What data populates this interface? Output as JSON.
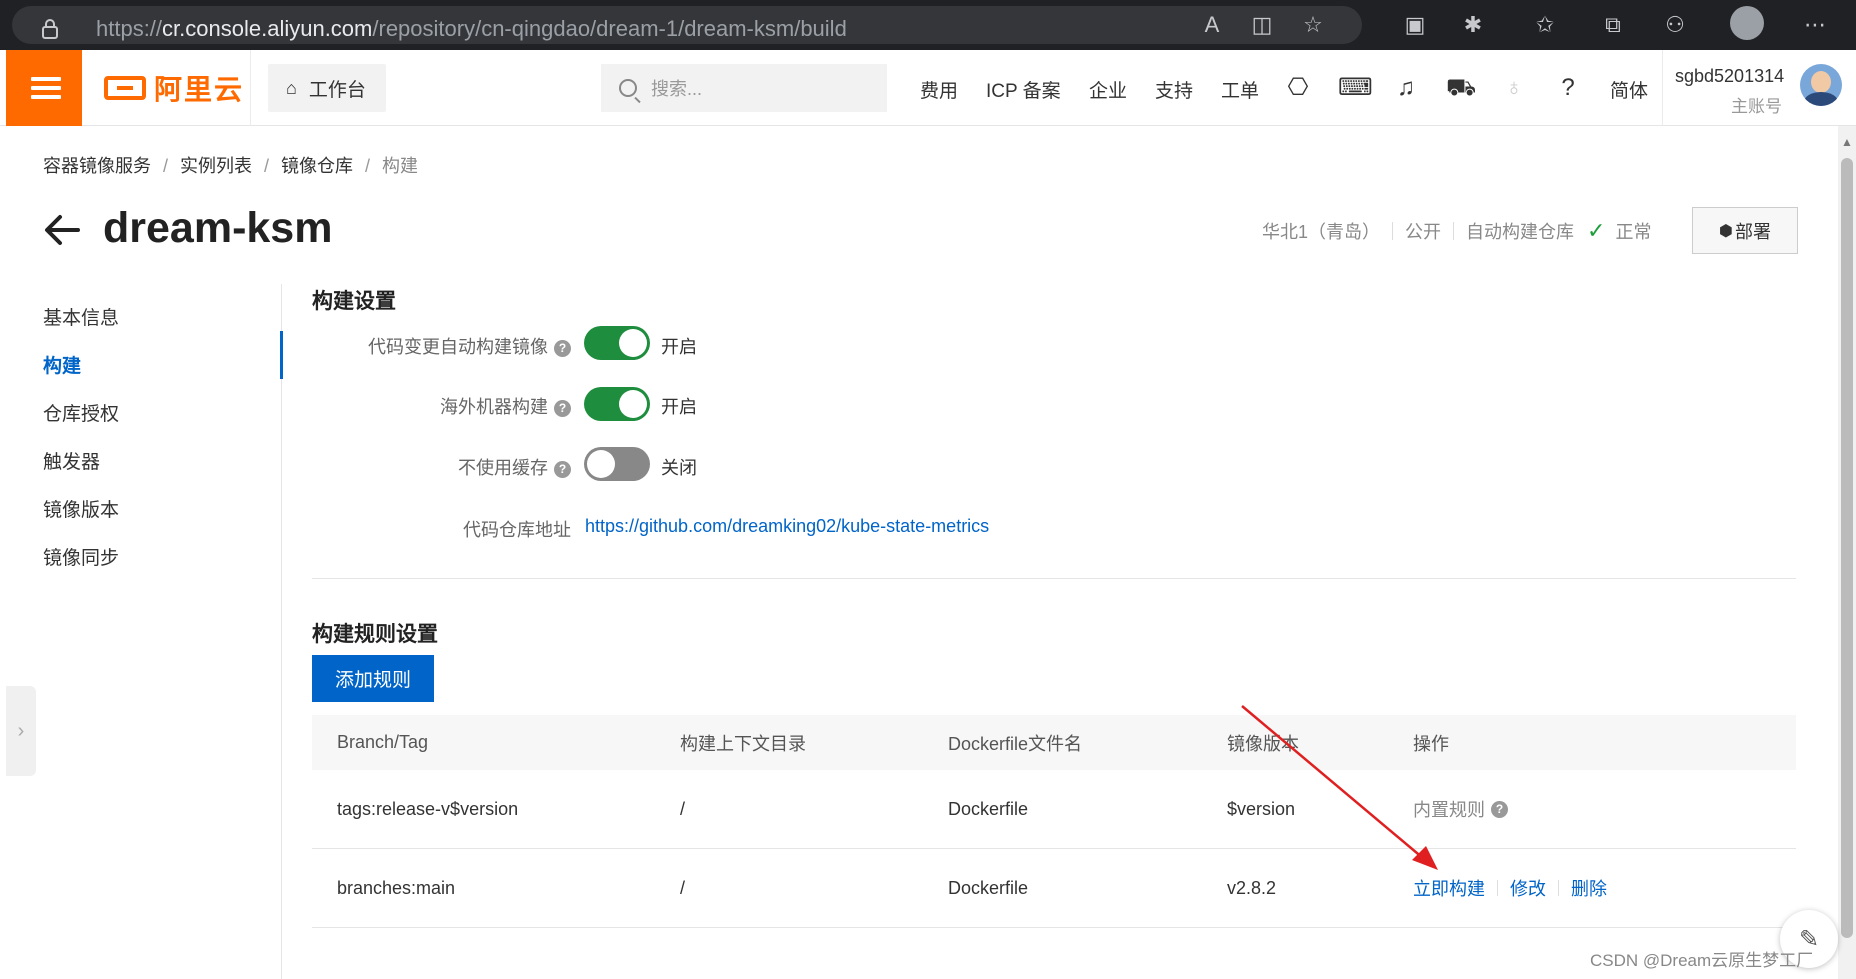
{
  "browser": {
    "url_prefix": "https://",
    "url_host": "cr.console.aliyun.com",
    "url_path": "/repository/cn-qingdao/dream-1/dream-ksm/build"
  },
  "topnav": {
    "logo_text": "阿里云",
    "workbench_label": "工作台",
    "search_placeholder": "搜索...",
    "links": [
      "费用",
      "ICP 备案",
      "企业",
      "支持",
      "工单"
    ],
    "lang": "简体",
    "user_name": "sgbd5201314",
    "user_role": "主账号",
    "accent_color": "#ff6a00"
  },
  "breadcrumb": [
    "容器镜像服务",
    "实例列表",
    "镜像仓库",
    "构建"
  ],
  "page": {
    "title": "dream-ksm",
    "region": "华北1（青岛）",
    "visibility": "公开",
    "repo_type": "自动构建仓库",
    "status": "正常",
    "deploy_label": "部署"
  },
  "sidemenu": {
    "items": [
      "基本信息",
      "构建",
      "仓库授权",
      "触发器",
      "镜像版本",
      "镜像同步"
    ],
    "active_index": 1
  },
  "build_settings": {
    "title": "构建设置",
    "auto_build_label": "代码变更自动构建镜像",
    "auto_build_state": "开启",
    "overseas_label": "海外机器构建",
    "overseas_state": "开启",
    "no_cache_label": "不使用缓存",
    "no_cache_state": "关闭",
    "repo_url_label": "代码仓库地址",
    "repo_url": "https://github.com/dreamking02/kube-state-metrics"
  },
  "build_rules": {
    "title": "构建规则设置",
    "add_label": "添加规则",
    "columns": [
      "Branch/Tag",
      "构建上下文目录",
      "Dockerfile文件名",
      "镜像版本",
      "操作"
    ],
    "rows": [
      {
        "branch": "tags:release-v$version",
        "context": "/",
        "dockerfile": "Dockerfile",
        "version": "$version",
        "op_text": "内置规则"
      },
      {
        "branch": "branches:main",
        "context": "/",
        "dockerfile": "Dockerfile",
        "version": "v2.8.2",
        "op_build": "立即构建",
        "op_edit": "修改",
        "op_delete": "删除"
      }
    ]
  },
  "watermark": "CSDN @Dream云原生梦工厂"
}
